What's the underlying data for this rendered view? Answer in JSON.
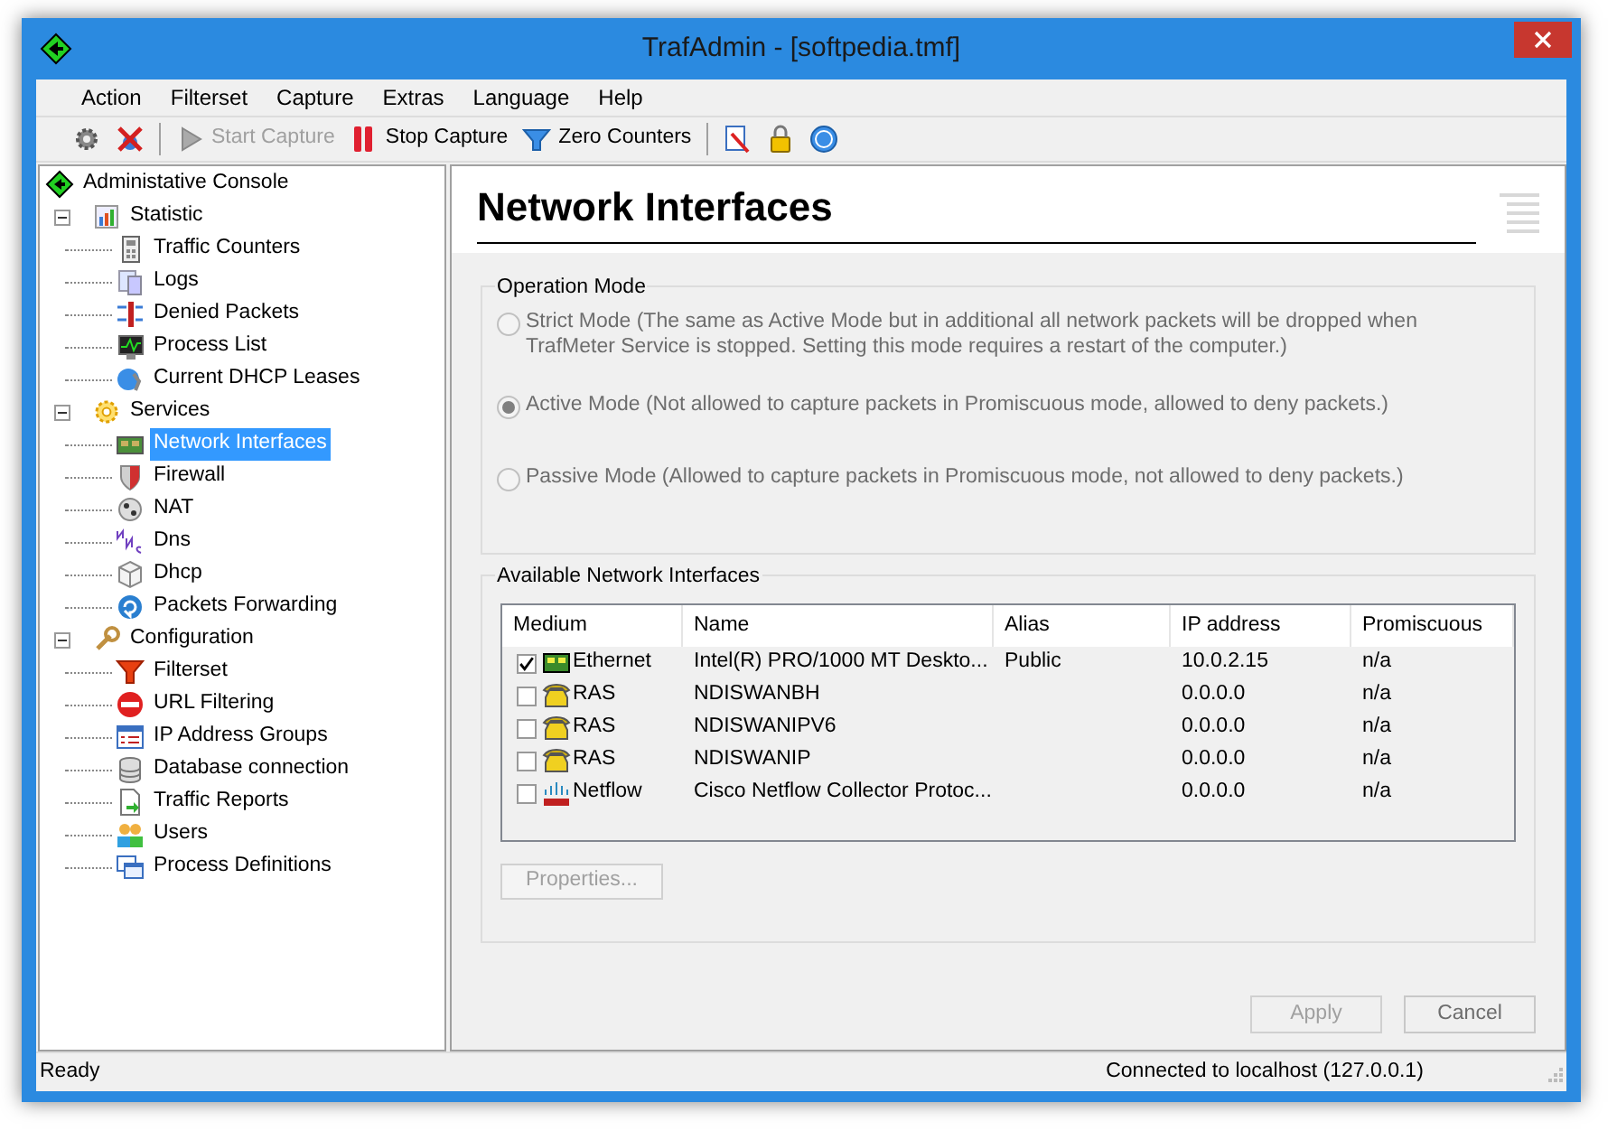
{
  "window": {
    "title": "TrafAdmin - [softpedia.tmf]"
  },
  "menu": [
    "Action",
    "Filterset",
    "Capture",
    "Extras",
    "Language",
    "Help"
  ],
  "toolbar": [
    {
      "kind": "icon"
    },
    {
      "kind": "icon"
    },
    {
      "kind": "separator"
    },
    {
      "kind": "button",
      "label": "Start Capture",
      "disabled": true
    },
    {
      "kind": "button",
      "label": "Stop Capture",
      "disabled": false
    },
    {
      "kind": "button",
      "label": "Zero Counters",
      "disabled": false
    },
    {
      "kind": "separator"
    },
    {
      "kind": "icon"
    },
    {
      "kind": "icon"
    },
    {
      "kind": "icon"
    }
  ],
  "tree": [
    {
      "label": "Administative Console",
      "selected": false,
      "children": [
        {
          "label": "Statistic",
          "expanded": true,
          "selected": false,
          "children": [
            {
              "label": "Traffic Counters",
              "selected": false
            },
            {
              "label": "Logs",
              "selected": false
            },
            {
              "label": "Denied Packets",
              "selected": false
            },
            {
              "label": "Process List",
              "selected": false
            },
            {
              "label": "Current DHCP Leases",
              "selected": false
            }
          ]
        },
        {
          "label": "Services",
          "expanded": true,
          "selected": false,
          "children": [
            {
              "label": "Network Interfaces",
              "selected": true
            },
            {
              "label": "Firewall",
              "selected": false
            },
            {
              "label": "NAT",
              "selected": false
            },
            {
              "label": "Dns",
              "selected": false
            },
            {
              "label": "Dhcp",
              "selected": false
            },
            {
              "label": "Packets Forwarding",
              "selected": false
            }
          ]
        },
        {
          "label": "Configuration",
          "expanded": true,
          "selected": false,
          "children": [
            {
              "label": "Filterset",
              "selected": false
            },
            {
              "label": "URL Filtering",
              "selected": false
            },
            {
              "label": "IP Address Groups",
              "selected": false
            },
            {
              "label": "Database connection",
              "selected": false
            },
            {
              "label": "Traffic Reports",
              "selected": false
            },
            {
              "label": "Users",
              "selected": false
            },
            {
              "label": "Process Definitions",
              "selected": false
            }
          ]
        }
      ]
    }
  ],
  "page_title": "Network Interfaces",
  "operation_mode": {
    "title": "Operation Mode",
    "options": [
      {
        "label": "Strict Mode (The same as Active Mode but in additional all network packets will be dropped when TrafMeter Service is stopped. Setting this mode requires a restart of the computer.)",
        "selected": false,
        "disabled": true
      },
      {
        "label": "Active Mode (Not allowed to capture packets in Promiscuous mode, allowed to deny packets.)",
        "selected": true,
        "disabled": true
      },
      {
        "label": "Passive Mode (Allowed to capture packets in Promiscuous mode, not allowed to deny packets.)",
        "selected": false,
        "disabled": true
      }
    ]
  },
  "interfaces": {
    "title": "Available Network Interfaces",
    "columns": [
      "Medium",
      "Name",
      "Alias",
      "IP address",
      "Promiscuous"
    ],
    "rows": [
      {
        "checked": true,
        "kind": "ethernet",
        "medium": "Ethernet",
        "name": "Intel(R) PRO/1000 MT Deskto...",
        "alias": "Public",
        "ip": "10.0.2.15",
        "promiscuous": "n/a"
      },
      {
        "checked": false,
        "kind": "ras",
        "medium": "RAS",
        "name": "NDISWANBH",
        "ip": "0.0.0.0",
        "promiscuous": "n/a"
      },
      {
        "checked": false,
        "kind": "ras",
        "medium": "RAS",
        "name": "NDISWANIPV6",
        "ip": "0.0.0.0",
        "promiscuous": "n/a"
      },
      {
        "checked": false,
        "kind": "ras",
        "medium": "RAS",
        "name": "NDISWANIP",
        "ip": "0.0.0.0",
        "promiscuous": "n/a"
      },
      {
        "checked": false,
        "kind": "netflow",
        "medium": "Netflow",
        "name": "Cisco Netflow Collector Protoc...",
        "ip": "0.0.0.0",
        "promiscuous": "n/a"
      }
    ]
  },
  "properties_button": {
    "label": "Properties...",
    "disabled": true
  },
  "buttons": [
    {
      "label": "Apply",
      "disabled": true
    },
    {
      "label": "Cancel",
      "disabled": false
    }
  ],
  "status_bar": {
    "left": "Ready",
    "right": "Connected to localhost (127.0.0.1)"
  }
}
